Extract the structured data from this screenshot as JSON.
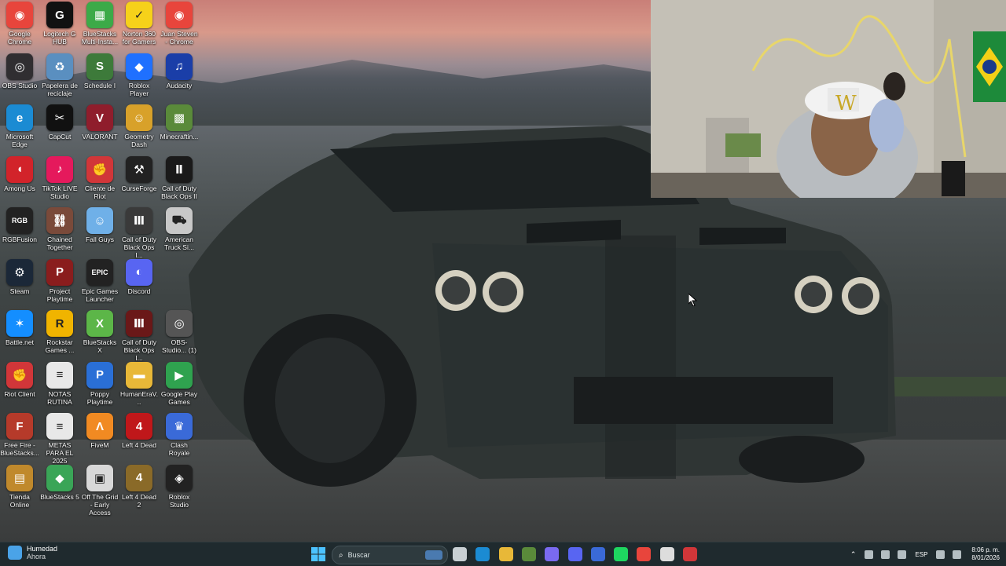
{
  "desktop": {
    "icons": [
      {
        "label": "Google Chrome",
        "icon": "chrome-icon",
        "color": "#e8453c",
        "glyph": "◉"
      },
      {
        "label": "OBS Studio",
        "icon": "obs-icon",
        "color": "#302e31",
        "glyph": "◎"
      },
      {
        "label": "Microsoft Edge",
        "icon": "edge-icon",
        "color": "#1b8bd3",
        "glyph": "e"
      },
      {
        "label": "Among Us",
        "icon": "among-us-icon",
        "color": "#d2232a",
        "glyph": "◖"
      },
      {
        "label": "RGBFusion",
        "icon": "rgbfusion-icon",
        "color": "#222222",
        "glyph": "RGB"
      },
      {
        "label": "Steam",
        "icon": "steam-icon",
        "color": "#1b2838",
        "glyph": "⚙"
      },
      {
        "label": "Battle.net",
        "icon": "battlenet-icon",
        "color": "#148eff",
        "glyph": "✶"
      },
      {
        "label": "Riot Client",
        "icon": "riot-client-icon",
        "color": "#d13639",
        "glyph": "✊"
      },
      {
        "label": "Free Fire - BlueStacks...",
        "icon": "free-fire-icon",
        "color": "#b63a2a",
        "glyph": "F"
      },
      {
        "label": "Tienda Online",
        "icon": "store-icon",
        "color": "#c0892c",
        "glyph": "▤"
      },
      {
        "label": "Logitech G HUB",
        "icon": "logitech-icon",
        "color": "#111111",
        "glyph": "G"
      },
      {
        "label": "Papelera de reciclaje",
        "icon": "recycle-bin-icon",
        "color": "#5a8fc0",
        "glyph": "♻"
      },
      {
        "label": "CapCut",
        "icon": "capcut-icon",
        "color": "#111111",
        "glyph": "✂"
      },
      {
        "label": "TikTok LIVE Studio",
        "icon": "tiktok-icon",
        "color": "#e5195c",
        "glyph": "♪"
      },
      {
        "label": "Chained Together",
        "icon": "chained-together-icon",
        "color": "#7a4a3a",
        "glyph": "⛓"
      },
      {
        "label": "Project Playtime",
        "icon": "project-playtime-icon",
        "color": "#8a1d1d",
        "glyph": "P"
      },
      {
        "label": "Rockstar Games ...",
        "icon": "rockstar-icon",
        "color": "#f0b400",
        "glyph": "R"
      },
      {
        "label": "NOTAS RUTINA",
        "icon": "text-file-icon",
        "color": "#e8e8e8",
        "glyph": "≡"
      },
      {
        "label": "METAS PARA EL 2025",
        "icon": "text-file-icon",
        "color": "#e8e8e8",
        "glyph": "≡"
      },
      {
        "label": "BlueStacks 5",
        "icon": "bluestacks-icon",
        "color": "#3aa557",
        "glyph": "◆"
      },
      {
        "label": "BlueStacks Multi-Insta...",
        "icon": "bluestacks-multi-icon",
        "color": "#3caa48",
        "glyph": "▦"
      },
      {
        "label": "Schedule I",
        "icon": "schedule-icon",
        "color": "#3d7a3a",
        "glyph": "S"
      },
      {
        "label": "VALORANT",
        "icon": "valorant-icon",
        "color": "#8f1d2c",
        "glyph": "V"
      },
      {
        "label": "Cliente de Riot",
        "icon": "riot-icon",
        "color": "#d13639",
        "glyph": "✊"
      },
      {
        "label": "Fall Guys",
        "icon": "fall-guys-icon",
        "color": "#6fb0e8",
        "glyph": "☺"
      },
      {
        "label": "Epic Games Launcher",
        "icon": "epic-icon",
        "color": "#222222",
        "glyph": "EPIC"
      },
      {
        "label": "BlueStacks X",
        "icon": "bluestacks-x-icon",
        "color": "#5cb648",
        "glyph": "X"
      },
      {
        "label": "Poppy Playtime",
        "icon": "poppy-icon",
        "color": "#2a6fd6",
        "glyph": "P"
      },
      {
        "label": "FiveM",
        "icon": "fivem-icon",
        "color": "#f18a22",
        "glyph": "Λ"
      },
      {
        "label": "Off The Grid - Early Access",
        "icon": "off-the-grid-icon",
        "color": "#d8d8d8",
        "glyph": "▣"
      },
      {
        "label": "Norton 360 for Gamers",
        "icon": "norton-icon",
        "color": "#f6d11a",
        "glyph": "✓"
      },
      {
        "label": "Roblox Player",
        "icon": "roblox-icon",
        "color": "#1f70ff",
        "glyph": "◆"
      },
      {
        "label": "Geometry Dash",
        "icon": "geometry-dash-icon",
        "color": "#d8a12a",
        "glyph": "☺"
      },
      {
        "label": "CurseForge",
        "icon": "curseforge-icon",
        "color": "#222222",
        "glyph": "⚒"
      },
      {
        "label": "Call of Duty Black Ops I...",
        "icon": "cod-icon",
        "color": "#3a3a3a",
        "glyph": "Ⅲ"
      },
      {
        "label": "Discord",
        "icon": "discord-icon",
        "color": "#5865f2",
        "glyph": "◐"
      },
      {
        "label": "Call of Duty Black Ops I...",
        "icon": "cod-icon",
        "color": "#6a1818",
        "glyph": "Ⅲ"
      },
      {
        "label": "HumanEraV...",
        "icon": "folder-icon",
        "color": "#e8b838",
        "glyph": "▬"
      },
      {
        "label": "Left 4 Dead",
        "icon": "left4dead-icon",
        "color": "#c0171a",
        "glyph": "4"
      },
      {
        "label": "Left 4 Dead 2",
        "icon": "left4dead2-icon",
        "color": "#8a6a28",
        "glyph": "4"
      },
      {
        "label": "Juan Steven - Chrome",
        "icon": "chrome-profile-icon",
        "color": "#e8453c",
        "glyph": "◉"
      },
      {
        "label": "Audacity",
        "icon": "audacity-icon",
        "color": "#1a3ea8",
        "glyph": "♫"
      },
      {
        "label": "Minecraftin...",
        "icon": "minecraft-icon",
        "color": "#5a8a3a",
        "glyph": "▩"
      },
      {
        "label": "Call of Duty Black Ops II",
        "icon": "cod-bo2-icon",
        "color": "#1a1a1a",
        "glyph": "Ⅱ"
      },
      {
        "label": "American Truck Si...",
        "icon": "truck-sim-icon",
        "color": "#c8c8c8",
        "glyph": "⛟"
      },
      {
        "label": "",
        "icon": "empty",
        "color": "transparent",
        "glyph": ""
      },
      {
        "label": "OBS-Studio... (1)",
        "icon": "obs-installer-icon",
        "color": "#555555",
        "glyph": "◎"
      },
      {
        "label": "Google Play Games",
        "icon": "google-play-games-icon",
        "color": "#2fa24f",
        "glyph": "▶"
      },
      {
        "label": "Clash Royale",
        "icon": "clash-royale-icon",
        "color": "#3a6ad8",
        "glyph": "♛"
      },
      {
        "label": "Roblox Studio",
        "icon": "roblox-studio-icon",
        "color": "#222222",
        "glyph": "◈"
      }
    ]
  },
  "taskbar": {
    "weather_title": "Humedad",
    "weather_subtitle": "Ahora",
    "search_placeholder": "Buscar",
    "language": "ESP",
    "time": "8:06 p. m.",
    "date": "8/01/2026",
    "apps": [
      {
        "name": "task-view",
        "color": "#c8d0d4"
      },
      {
        "name": "edge",
        "color": "#1b8bd3"
      },
      {
        "name": "file-explorer",
        "color": "#e8b838"
      },
      {
        "name": "minecraft",
        "color": "#5a8a3a"
      },
      {
        "name": "copilot",
        "color": "#7a6af0"
      },
      {
        "name": "discord",
        "color": "#5865f2"
      },
      {
        "name": "lunar-client",
        "color": "#3a6ad8"
      },
      {
        "name": "spotify",
        "color": "#1ed760"
      },
      {
        "name": "chrome",
        "color": "#e8453c"
      },
      {
        "name": "obs-studio",
        "color": "#dddddd"
      },
      {
        "name": "riot-client",
        "color": "#d13639"
      }
    ]
  }
}
